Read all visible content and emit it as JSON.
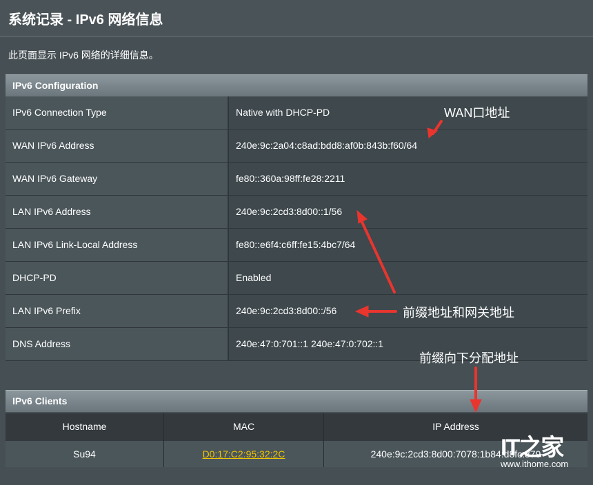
{
  "page_title": "系统记录 - IPv6 网络信息",
  "description": "此页面显示 IPv6 网络的详细信息。",
  "configuration": {
    "header": "IPv6 Configuration",
    "rows": [
      {
        "label": "IPv6 Connection Type",
        "value": "Native with DHCP-PD"
      },
      {
        "label": "WAN IPv6 Address",
        "value": "240e:9c:2a04:c8ad:bdd8:af0b:843b:f60/64"
      },
      {
        "label": "WAN IPv6 Gateway",
        "value": "fe80::360a:98ff:fe28:2211"
      },
      {
        "label": "LAN IPv6 Address",
        "value": "240e:9c:2cd3:8d00::1/56"
      },
      {
        "label": "LAN IPv6 Link-Local Address",
        "value": "fe80::e6f4:c6ff:fe15:4bc7/64"
      },
      {
        "label": "DHCP-PD",
        "value": "Enabled"
      },
      {
        "label": "LAN IPv6 Prefix",
        "value": "240e:9c:2cd3:8d00::/56"
      },
      {
        "label": "DNS Address",
        "value": "240e:47:0:701::1 240e:47:0:702::1"
      }
    ]
  },
  "clients": {
    "header": "IPv6 Clients",
    "columns": [
      "Hostname",
      "MAC",
      "IP Address"
    ],
    "rows": [
      {
        "hostname": "Su94",
        "mac": "D0:17:C2:95:32:2C",
        "ip": "240e:9c:2cd3:8d00:7078:1b84:d8fc:879"
      }
    ]
  },
  "annotations": {
    "wan": "WAN口地址",
    "prefix_gateway": "前缀地址和网关地址",
    "prefix_delegation": "前缀向下分配地址"
  },
  "watermark": {
    "logo": "IT之家",
    "url": "www.ithome.com"
  },
  "colors": {
    "background": "#464f54",
    "header_bar": "#7d898f",
    "accent_link": "#f0c400",
    "annotation_arrow": "#e8352e"
  }
}
